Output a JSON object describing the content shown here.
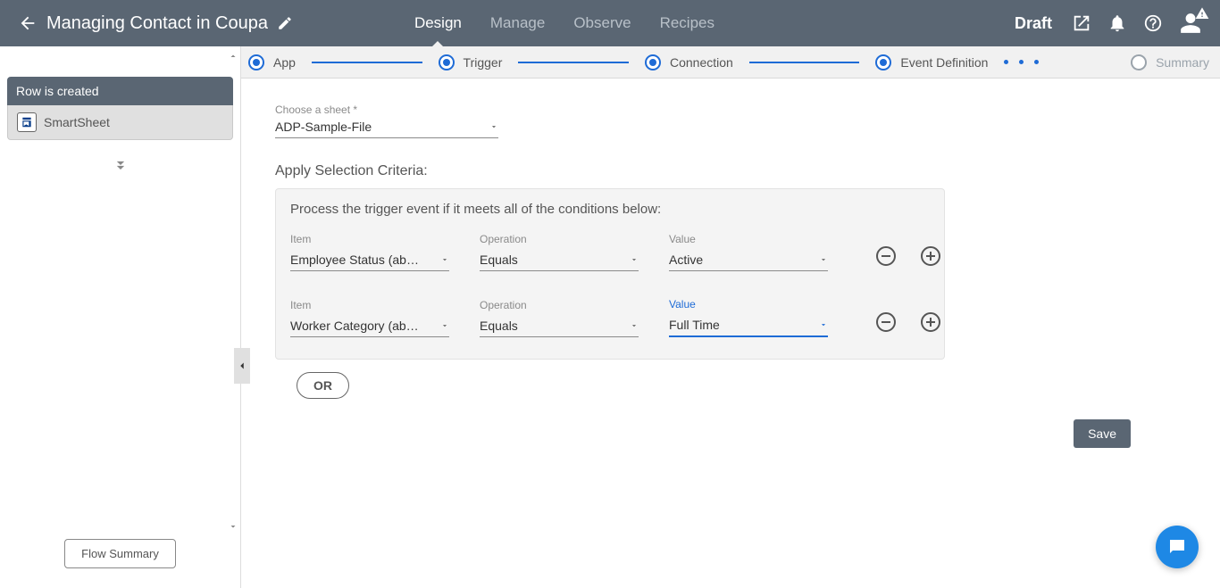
{
  "header": {
    "title": "Managing Contact in Coupa",
    "tabs": [
      "Design",
      "Manage",
      "Observe",
      "Recipes"
    ],
    "activeTab": 0,
    "status": "Draft"
  },
  "stepper": {
    "steps": [
      "App",
      "Trigger",
      "Connection",
      "Event Definition",
      "Summary"
    ],
    "active": 3
  },
  "sidebar": {
    "panel_title": "Row is created",
    "app_name": "SmartSheet",
    "summary_button": "Flow Summary"
  },
  "form": {
    "sheet_label": "Choose a sheet *",
    "sheet_value": "ADP-Sample-File",
    "criteria_title": "Apply Selection Criteria:",
    "criteria_desc": "Process the trigger event if it meets all of the conditions below:",
    "rows": [
      {
        "item_label": "Item",
        "item_value": "Employee Status  (ab…",
        "op_label": "Operation",
        "op_value": "Equals",
        "val_label": "Value",
        "val_value": "Active",
        "active": false
      },
      {
        "item_label": "Item",
        "item_value": "Worker Category  (ab…",
        "op_label": "Operation",
        "op_value": "Equals",
        "val_label": "Value",
        "val_value": "Full Time",
        "active": true
      }
    ],
    "or_label": "OR",
    "save_label": "Save"
  }
}
